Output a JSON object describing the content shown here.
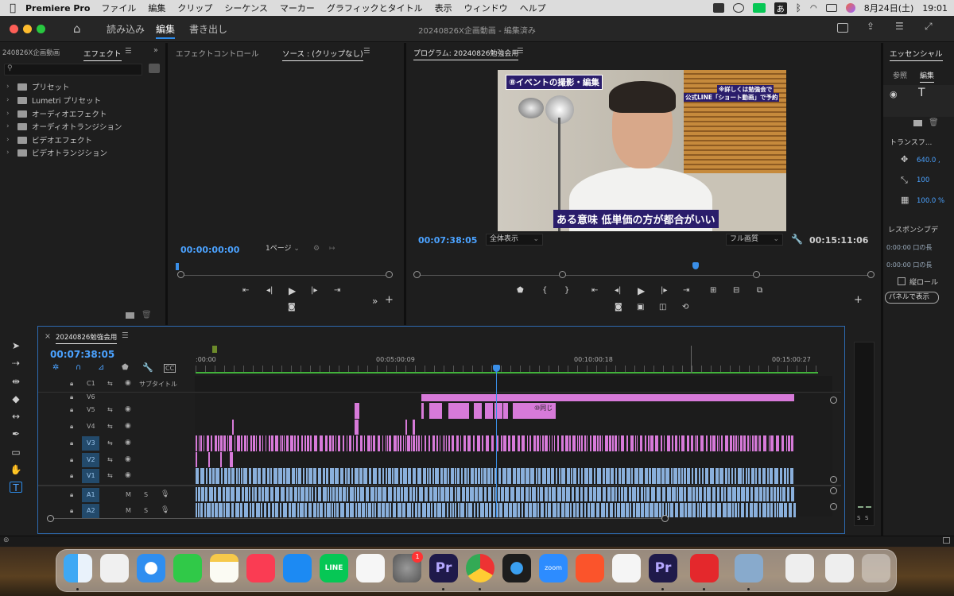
{
  "menubar": {
    "app": "Premiere Pro",
    "items": [
      "ファイル",
      "編集",
      "クリップ",
      "シーケンス",
      "マーカー",
      "グラフィックとタイトル",
      "表示",
      "ウィンドウ",
      "ヘルプ"
    ],
    "date": "8月24日(土)",
    "time": "19:01",
    "ime": "あ"
  },
  "header": {
    "workspaces": [
      "読み込み",
      "編集",
      "書き出し"
    ],
    "active": "編集",
    "title": "20240826X企画動画 - 編集済み"
  },
  "effects": {
    "tab_project": "240826X企画動画",
    "tab_effects": "エフェクト",
    "items": [
      "プリセット",
      "Lumetri プリセット",
      "オーディオエフェクト",
      "オーディオトランジション",
      "ビデオエフェクト",
      "ビデオトランジション"
    ]
  },
  "source": {
    "tab_effect_controls": "エフェクトコントロール",
    "tab_source": "ソース : (クリップなし)",
    "timecode": "00:00:00:00",
    "page_select": "1ページ"
  },
  "program": {
    "tab": "プログラム: 20240826勉強会用",
    "timecode": "00:07:38:05",
    "zoom": "全体表示",
    "quality": "フル画質",
    "duration": "00:15:11:06",
    "overlay_title": "⑧イベントの撮影・編集",
    "overlay_info1": "※詳しくは勉強会で",
    "overlay_info2": "公式LINE「ショート動画」で予約",
    "caption": "ある意味 低単価の方が都合がいい"
  },
  "essential": {
    "tab": "エッセンシャル",
    "sub_browse": "参照",
    "sub_edit": "編集",
    "transform": "トランスフ...",
    "pos": "640.0 ,",
    "scale": "100",
    "opacity": "100.0 %",
    "responsive": "レスポンシブデ",
    "r1": "0:00:00 口の長",
    "r2": "0:00:00 口の長",
    "roll": "縦ロール",
    "panel_btn": "パネルで表示"
  },
  "timeline": {
    "tab": "20240826勉強会用",
    "timecode": "00:07:38:05",
    "ruler": [
      ":00:00",
      "00:05:00:09",
      "00:10:00:18",
      "00:15:00:27"
    ],
    "tracks": [
      {
        "id": "C1",
        "label": "サブタイトル"
      },
      {
        "id": "V6"
      },
      {
        "id": "V5"
      },
      {
        "id": "V4"
      },
      {
        "id": "V3"
      },
      {
        "id": "V2"
      },
      {
        "id": "V1"
      },
      {
        "id": "A1"
      },
      {
        "id": "A2"
      }
    ],
    "clip_label": "⑩同じ",
    "audio_btns": [
      "M",
      "S"
    ]
  },
  "colors": {
    "accent": "#2d8ceb",
    "video_clip": "#d77ad9",
    "audio_clip": "#8ab0dc",
    "timecode": "#4ba2ff",
    "playhead": "#3a8fe8"
  },
  "dock": {
    "apps": [
      "finder",
      "launchpad",
      "safari",
      "facetime",
      "notes",
      "music",
      "app-store",
      "line",
      "slack",
      "system-settings",
      "premiere-pro",
      "chrome",
      "quicktime",
      "zoom",
      "brave",
      "spark",
      "premiere-pro",
      "pdf-app",
      "preview",
      "screenshot",
      "screenshot",
      "trash"
    ],
    "badge": "1",
    "line_label": "LINE",
    "zoom_label": "zoom",
    "pr_label": "Pr"
  }
}
